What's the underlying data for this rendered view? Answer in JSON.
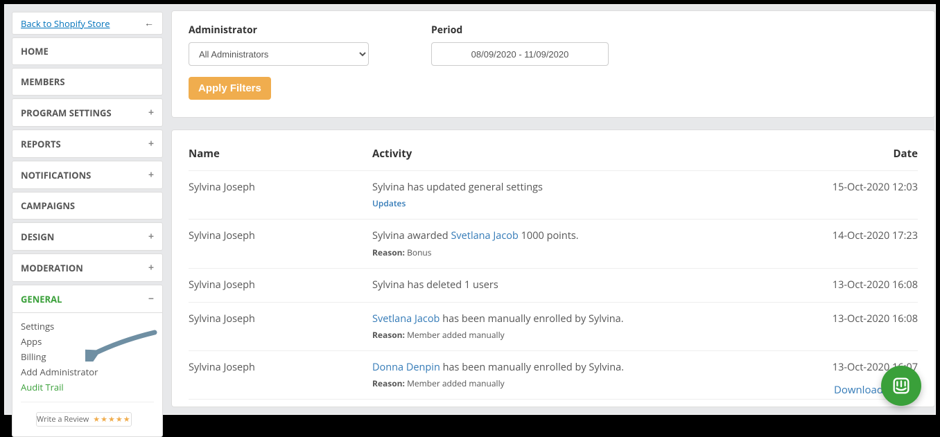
{
  "sidebar": {
    "back_link": "Back to Shopify Store",
    "items": [
      {
        "label": "HOME",
        "expandable": false
      },
      {
        "label": "MEMBERS",
        "expandable": false
      },
      {
        "label": "PROGRAM SETTINGS",
        "expandable": true
      },
      {
        "label": "REPORTS",
        "expandable": true
      },
      {
        "label": "NOTIFICATIONS",
        "expandable": true
      },
      {
        "label": "CAMPAIGNS",
        "expandable": false
      },
      {
        "label": "DESIGN",
        "expandable": true
      },
      {
        "label": "MODERATION",
        "expandable": true
      },
      {
        "label": "GENERAL",
        "expandable": true,
        "active": true,
        "expanded": true
      }
    ],
    "general_sub": [
      {
        "label": "Settings"
      },
      {
        "label": "Apps"
      },
      {
        "label": "Billing"
      },
      {
        "label": "Add Administrator"
      },
      {
        "label": "Audit Trail",
        "active": true
      }
    ],
    "review_label": "Write a Review"
  },
  "filters": {
    "admin_label": "Administrator",
    "admin_select": "All Administrators",
    "period_label": "Period",
    "period_value": "08/09/2020 - 11/09/2020",
    "apply_label": "Apply Filters"
  },
  "table": {
    "headers": {
      "name": "Name",
      "activity": "Activity",
      "date": "Date"
    },
    "rows": [
      {
        "name": "Sylvina Joseph",
        "activity_html": "Sylvina has updated general settings",
        "sub_link": "Updates",
        "date": "15-Oct-2020 12:03"
      },
      {
        "name": "Sylvina Joseph",
        "a_pre": "Sylvina awarded ",
        "a_link": "Svetlana Jacob",
        "a_post": " 1000 points.",
        "reason": "Bonus",
        "date": "14-Oct-2020 17:23"
      },
      {
        "name": "Sylvina Joseph",
        "activity_html": "Sylvina has deleted 1 users",
        "date": "13-Oct-2020 16:08"
      },
      {
        "name": "Sylvina Joseph",
        "a_link": "Svetlana Jacob",
        "a_post": " has been manually enrolled by Sylvina.",
        "reason": "Member added manually",
        "date": "13-Oct-2020 16:08"
      },
      {
        "name": "Sylvina Joseph",
        "a_link": "Donna Denpin",
        "a_post": " has been manually enrolled by Sylvina.",
        "reason": "Member added manually",
        "date": "13-Oct-2020 16:07"
      }
    ],
    "download": "Download",
    "reason_label": "Reason:"
  }
}
